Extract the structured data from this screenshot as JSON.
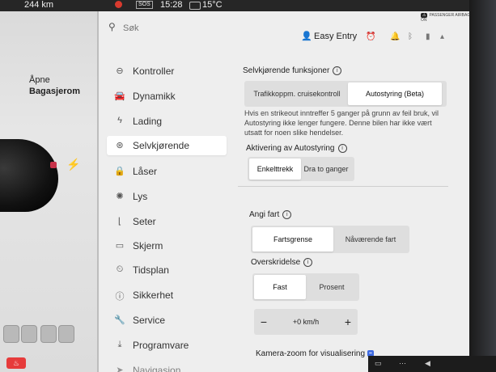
{
  "status_bar": {
    "distance": "244 km",
    "sos": "SOS",
    "time": "15:28",
    "temperature": "15°C"
  },
  "vehicle": {
    "trunk_label": "Åpne",
    "trunk_value": "Bagasjerom"
  },
  "topbar": {
    "search_placeholder": "Søk",
    "profile_name": "Easy Entry",
    "airbag_badge": "PASSENGER AIRBAG ON"
  },
  "nav": {
    "items": [
      {
        "label": "Kontroller",
        "icon": "toggle-icon"
      },
      {
        "label": "Dynamikk",
        "icon": "car-icon"
      },
      {
        "label": "Lading",
        "icon": "bolt-icon"
      },
      {
        "label": "Selvkjørende",
        "icon": "steering-wheel-icon"
      },
      {
        "label": "Låser",
        "icon": "lock-icon"
      },
      {
        "label": "Lys",
        "icon": "light-icon"
      },
      {
        "label": "Seter",
        "icon": "seat-icon"
      },
      {
        "label": "Skjerm",
        "icon": "display-icon"
      },
      {
        "label": "Tidsplan",
        "icon": "alarm-icon"
      },
      {
        "label": "Sikkerhet",
        "icon": "info-circle-icon"
      },
      {
        "label": "Service",
        "icon": "wrench-icon"
      },
      {
        "label": "Programvare",
        "icon": "download-icon"
      },
      {
        "label": "Navigasjon",
        "icon": "navigation-icon"
      }
    ],
    "active_index": 3
  },
  "autopilot": {
    "features_title": "Selvkjørende funksjoner",
    "features_options": [
      "Trafikkoppm. cruisekontroll",
      "Autostyring (Beta)"
    ],
    "features_selected": 1,
    "warning": "Hvis en strikeout inntreffer 5 ganger på grunn av feil bruk, vil Autostyring ikke lenger fungere. Denne bilen har ikke vært utsatt for noen slike hendelser.",
    "activation_title": "Aktivering av Autostyring",
    "activation_options": [
      "Enkelttrekk",
      "Dra to ganger"
    ],
    "activation_selected": 0,
    "speed_title": "Angi fart",
    "speed_options": [
      "Fartsgrense",
      "Nåværende fart"
    ],
    "speed_selected": 0,
    "offset_title": "Overskridelse",
    "offset_options": [
      "Fast",
      "Prosent"
    ],
    "offset_selected": 0,
    "offset_value": "+0 km/h",
    "stepper_minus": "−",
    "stepper_plus": "+",
    "camera_zoom_title": "Kamera-zoom for visualisering"
  },
  "colors": {
    "accent": "#3e6ae1",
    "record": "#d83a2e",
    "panel_bg": "#eeeeee",
    "active_item": "#ffffff"
  }
}
